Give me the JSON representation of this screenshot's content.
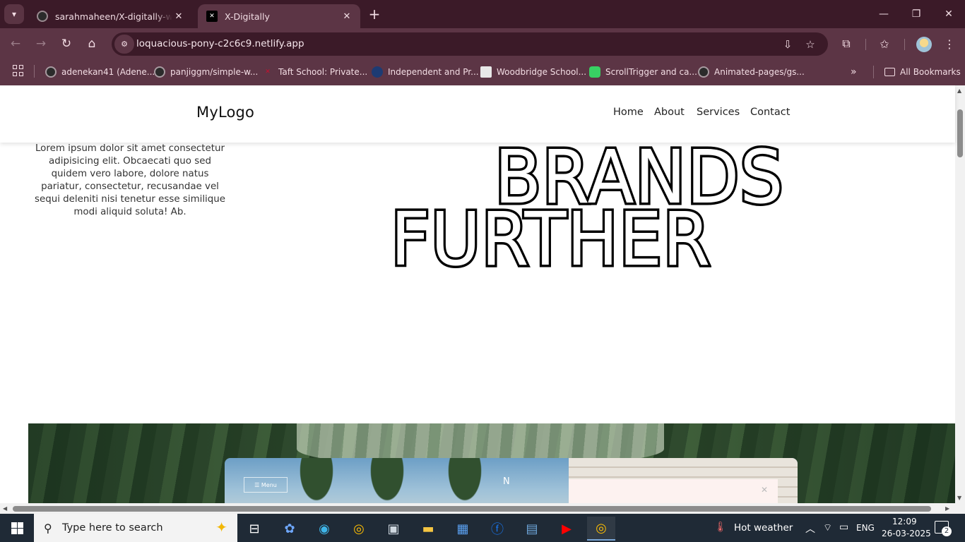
{
  "browser": {
    "tabs": [
      {
        "title": "sarahmaheen/X-digitally-website"
      },
      {
        "title": "X-Digitally"
      }
    ],
    "url": "loquacious-pony-c2c6c9.netlify.app",
    "bookmarks": [
      {
        "label": "adenekan41 (Adene..."
      },
      {
        "label": "panjiggm/simple-w..."
      },
      {
        "label": "Taft School: Private..."
      },
      {
        "label": "Independent and Pr..."
      },
      {
        "label": "Woodbridge School..."
      },
      {
        "label": "ScrollTrigger and ca..."
      },
      {
        "label": "Animated-pages/gs..."
      }
    ],
    "all_bookmarks_label": "All Bookmarks"
  },
  "site": {
    "logo": "MyLogo",
    "nav": [
      "Home",
      "About",
      "Services",
      "Contact"
    ],
    "hero_text": "Lorem ipsum dolor sit amet consectetur adipisicing elit. Obcaecati quo sed quidem vero labore, dolore natus pariatur, consectetur, recusandae vel sequi deleniti nisi tenetur esse similique modi aliquid soluta! Ab.",
    "hero_word_1": "BRANDS",
    "hero_word_2": "FURTHER",
    "showcase_menu_label": "Menu"
  },
  "taskbar": {
    "search_placeholder": "Type here to search",
    "weather": "Hot weather",
    "language": "ENG",
    "time": "12:09",
    "date": "26-03-2025",
    "notifications": "2"
  }
}
